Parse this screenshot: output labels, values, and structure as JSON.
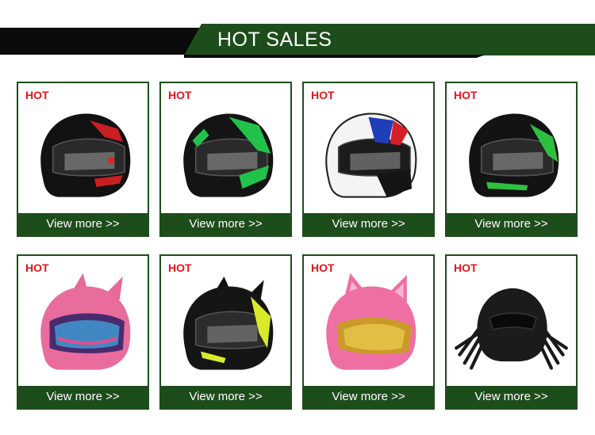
{
  "header": {
    "title": "HOT SALES"
  },
  "colors": {
    "brand_green": "#1e4d1c",
    "hot_red": "#e2151b",
    "dark": "#0b0b0b"
  },
  "products": [
    {
      "badge": "HOT",
      "button_label": "View more >>",
      "image": "black helmet with red graphics"
    },
    {
      "badge": "HOT",
      "button_label": "View more >>",
      "image": "black helmet with green graphics"
    },
    {
      "badge": "HOT",
      "button_label": "View more >>",
      "image": "white helmet with blue and red graphics"
    },
    {
      "badge": "HOT",
      "button_label": "View more >>",
      "image": "black helmet with green stripes"
    },
    {
      "badge": "HOT",
      "button_label": "View more >>",
      "image": "pink helmet with horns and iridescent visor"
    },
    {
      "badge": "HOT",
      "button_label": "View more >>",
      "image": "black helmet with yellow graphics and horns"
    },
    {
      "badge": "HOT",
      "button_label": "View more >>",
      "image": "pink cat-ear helmet with gold visor"
    },
    {
      "badge": "HOT",
      "button_label": "View more >>",
      "image": "black predator-style helmet with dreadlocks"
    }
  ]
}
